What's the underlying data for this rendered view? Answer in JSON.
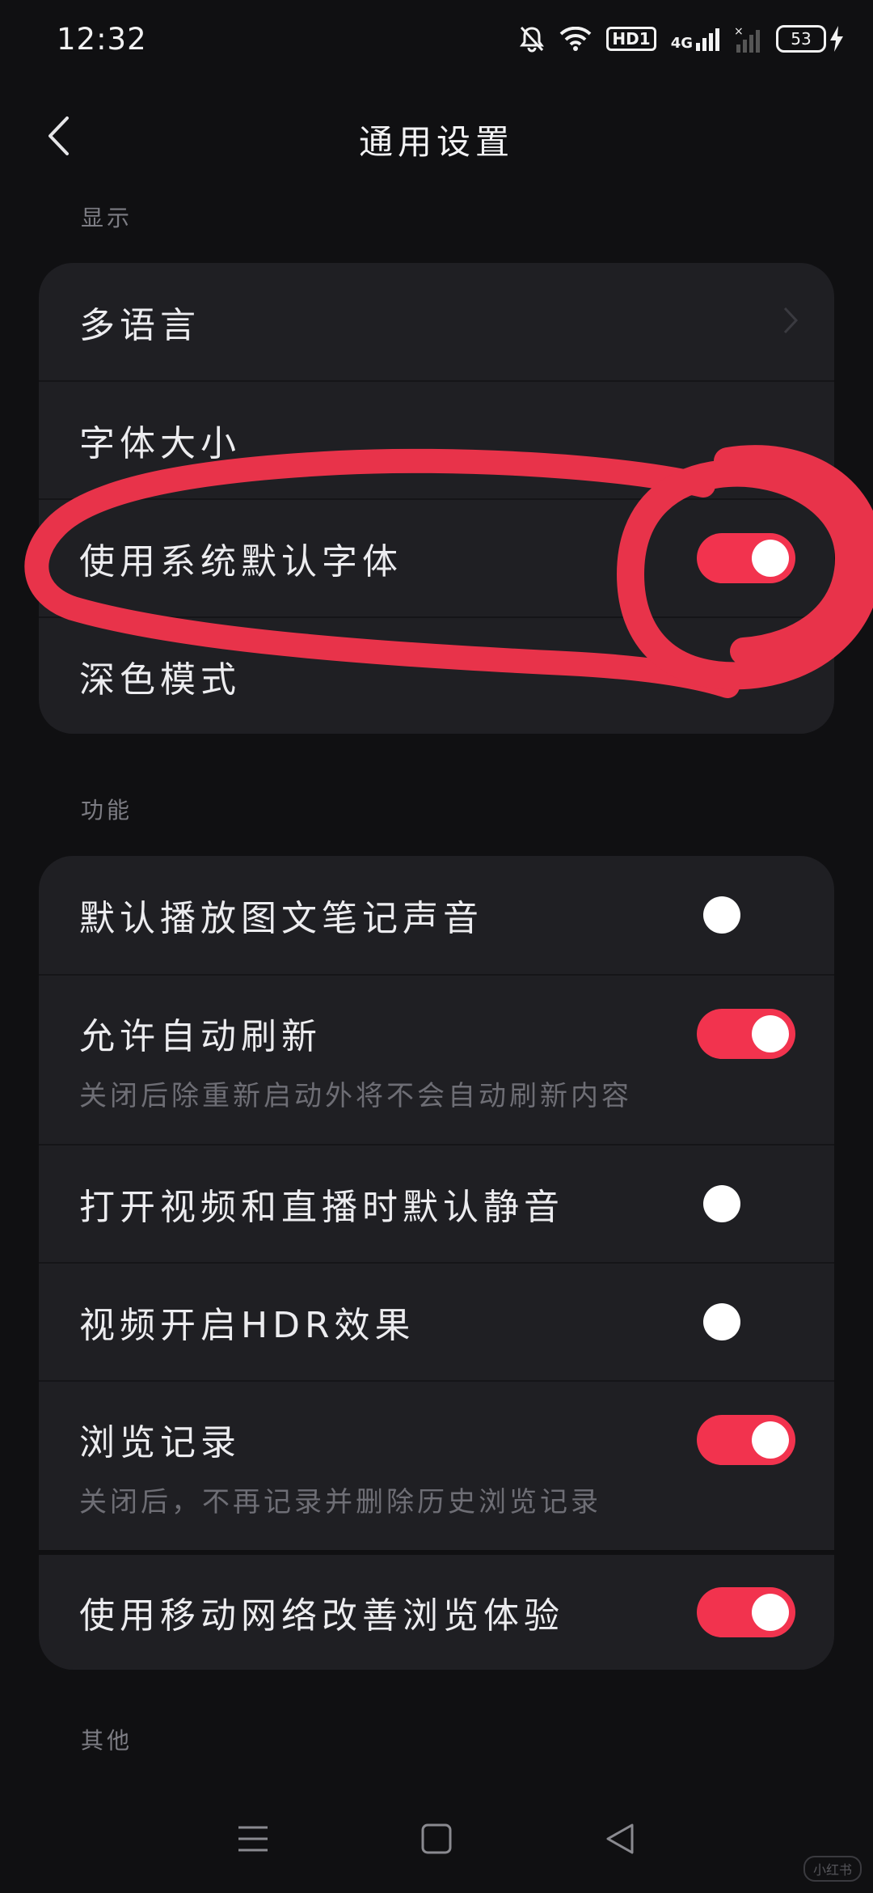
{
  "status_bar": {
    "time": "12:32",
    "hd_badge": "HD1",
    "network": "4G",
    "battery": "53"
  },
  "header": {
    "title": "通用设置",
    "back_icon": "chevron-left-icon"
  },
  "sections": {
    "display": {
      "label": "显示"
    },
    "function": {
      "label": "功能"
    },
    "other": {
      "label": "其他"
    }
  },
  "display_items": {
    "multi_language": {
      "label": "多语言"
    },
    "font_size": {
      "label": "字体大小"
    },
    "system_font": {
      "label": "使用系统默认字体",
      "on": true
    },
    "dark_mode": {
      "label": "深色模式"
    }
  },
  "function_items": {
    "autoplay_sound": {
      "label": "默认播放图文笔记声音",
      "on": false
    },
    "auto_refresh": {
      "label": "允许自动刷新",
      "sub": "关闭后除重新启动外将不会自动刷新内容",
      "on": true
    },
    "mute_default": {
      "label": "打开视频和直播时默认静音",
      "on": false
    },
    "hdr": {
      "label": "视频开启HDR效果",
      "on": false
    },
    "history": {
      "label": "浏览记录",
      "sub": "关闭后，不再记录并删除历史浏览记录",
      "on": true
    },
    "mobile_network": {
      "label": "使用移动网络改善浏览体验",
      "on": true
    }
  },
  "colors": {
    "accent": "#f2334e",
    "background": "#101012",
    "card": "#1f1f23",
    "annotation": "#e8334a"
  },
  "watermark": "小红书"
}
